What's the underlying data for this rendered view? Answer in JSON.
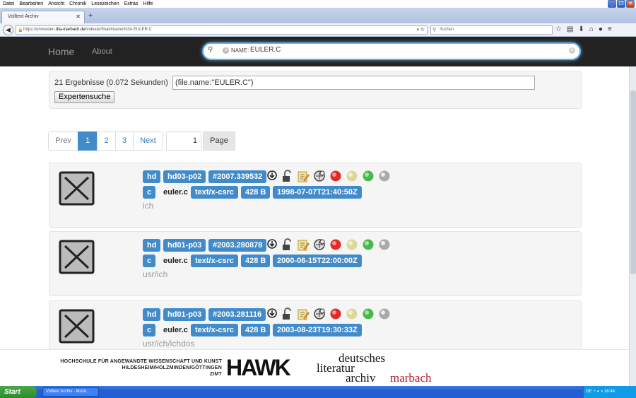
{
  "menu": {
    "items": [
      "Datei",
      "Bearbeiten",
      "Ansicht",
      "Chronik",
      "Lesezeichen",
      "Extras",
      "Hilfe"
    ]
  },
  "browser": {
    "tab_title": "Volltext Archiv",
    "url_prefix": "https://onmeiden.",
    "url_host": "dla-marbach.de",
    "url_suffix": "/indexer/final/#name%3A EULER.C",
    "search_placeholder": "Suchen"
  },
  "site": {
    "brand": "Home",
    "about": "About",
    "search": {
      "tag_name": "NAME:",
      "tag_value": "EULER.C"
    }
  },
  "query": {
    "summary": "21 Ergebnisse (0.072 Sekunden)",
    "expression": "(file.name:\"EULER.C\")",
    "expert_button": "Expertensuche"
  },
  "pagination": {
    "prev": "Prev",
    "pages": [
      "1",
      "2",
      "3"
    ],
    "active": "1",
    "next": "Next",
    "page_input": "1",
    "page_button": "Page"
  },
  "results": [
    {
      "disk": "hd",
      "part": "hd03-p02",
      "id": "#2007.339532",
      "type_letter": "c",
      "filename": "euler.c",
      "mime": "text/x-csrc",
      "size": "428 B",
      "date": "1998-07-07T21:40:50Z",
      "path": "ich"
    },
    {
      "disk": "hd",
      "part": "hd01-p03",
      "id": "#2003.280878",
      "type_letter": "c",
      "filename": "euler.c",
      "mime": "text/x-csrc",
      "size": "428 B",
      "date": "2000-06-15T22:00:00Z",
      "path": "usr/ich"
    },
    {
      "disk": "hd",
      "part": "hd01-p03",
      "id": "#2003.281116",
      "type_letter": "c",
      "filename": "euler.c",
      "mime": "text/x-csrc",
      "size": "428 B",
      "date": "2003-08-23T19:30:33Z",
      "path": "usr/ich/ichdos"
    }
  ],
  "footer": {
    "hawk_line1": "HOCHSCHULE FÜR ANGEWANDTE WISSENSCHAFT UND KUNST",
    "hawk_line2": "HILDESHEIM/HOLZMINDEN/GÖTTINGEN",
    "hawk_line3": "ZIMT",
    "hawk_logo": "HAWK",
    "dla_1": "deutsches",
    "dla_2": "literatur",
    "dla_3": "archiv",
    "dla_4": "marbach"
  },
  "taskbar": {
    "start": "Start",
    "task": "Volltext Archiv - Mozil...",
    "lang": "DE",
    "clock": "16:44"
  },
  "icons": [
    "download-icon",
    "unlock-icon",
    "edit-icon",
    "compare-icon",
    "red-status-icon",
    "yellow-status-icon",
    "green-status-icon",
    "grey-status-icon"
  ],
  "colors": {
    "accent": "#428bca",
    "navbar": "#222222",
    "marbach_red": "#b21e2e"
  }
}
